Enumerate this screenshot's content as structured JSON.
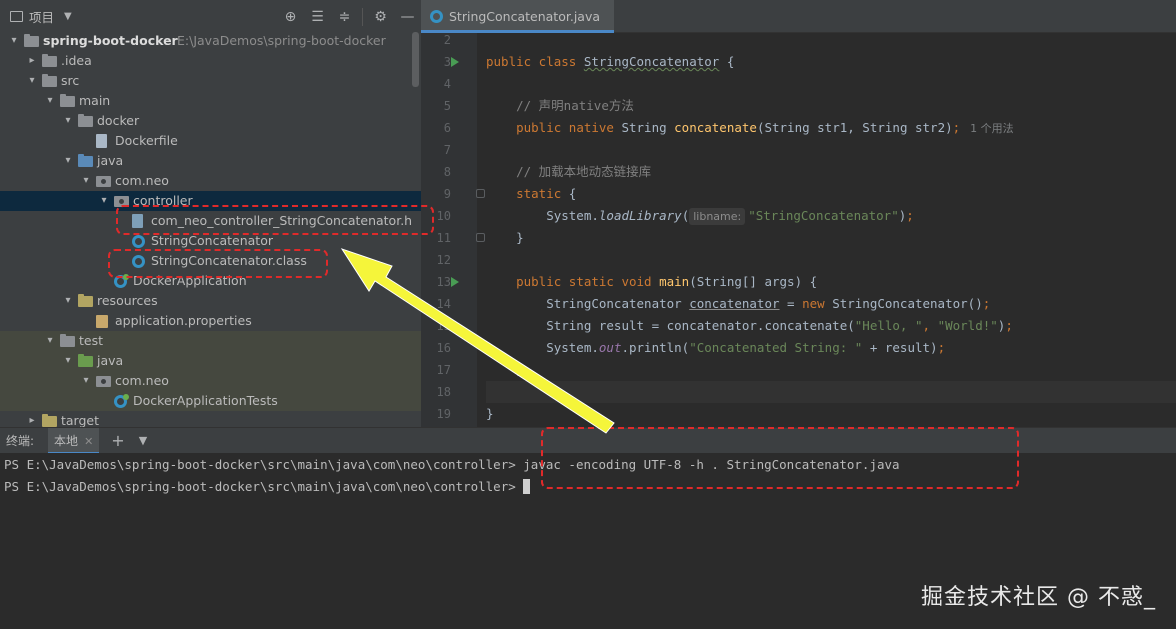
{
  "project_panel": {
    "title": "项目",
    "tree": [
      {
        "depth": 0,
        "arrow": "▾",
        "icon": "folder",
        "label": "spring-boot-docker",
        "hint": "E:\\JavaDemos\\spring-boot-docker",
        "bold": true
      },
      {
        "depth": 1,
        "arrow": "▸",
        "icon": "folder",
        "label": ".idea"
      },
      {
        "depth": 1,
        "arrow": "▾",
        "icon": "folder",
        "label": "src"
      },
      {
        "depth": 2,
        "arrow": "▾",
        "icon": "folder",
        "label": "main"
      },
      {
        "depth": 3,
        "arrow": "▾",
        "icon": "folder",
        "label": "docker"
      },
      {
        "depth": 4,
        "arrow": "",
        "icon": "file",
        "label": "Dockerfile"
      },
      {
        "depth": 3,
        "arrow": "▾",
        "icon": "folder-blue",
        "label": "java"
      },
      {
        "depth": 4,
        "arrow": "▾",
        "icon": "package",
        "label": "com.neo"
      },
      {
        "depth": 5,
        "arrow": "▾",
        "icon": "package",
        "label": "controller",
        "selected": true
      },
      {
        "depth": 6,
        "arrow": "",
        "icon": "file-h",
        "label": "com_neo_controller_StringConcatenator.h"
      },
      {
        "depth": 6,
        "arrow": "",
        "icon": "class",
        "label": "StringConcatenator"
      },
      {
        "depth": 6,
        "arrow": "",
        "icon": "class-file",
        "label": "StringConcatenator.class"
      },
      {
        "depth": 5,
        "arrow": "",
        "icon": "class-spring",
        "label": "DockerApplication"
      },
      {
        "depth": 3,
        "arrow": "▾",
        "icon": "folder-res",
        "label": "resources"
      },
      {
        "depth": 4,
        "arrow": "",
        "icon": "props",
        "label": "application.properties"
      },
      {
        "depth": 2,
        "arrow": "▾",
        "icon": "folder",
        "label": "test",
        "band": true
      },
      {
        "depth": 3,
        "arrow": "▾",
        "icon": "folder-green",
        "label": "java",
        "band": true
      },
      {
        "depth": 4,
        "arrow": "▾",
        "icon": "package",
        "label": "com.neo",
        "band": true
      },
      {
        "depth": 5,
        "arrow": "",
        "icon": "class-spring",
        "label": "DockerApplicationTests",
        "band": true
      },
      {
        "depth": 1,
        "arrow": "▸",
        "icon": "folder-res",
        "label": "target"
      }
    ]
  },
  "editor": {
    "tab_label": "StringConcatenator.java",
    "line_numbers": [
      "2",
      "3",
      "4",
      "5",
      "6",
      "7",
      "8",
      "9",
      "10",
      "11",
      "12",
      "13",
      "14",
      "15",
      "16",
      "17",
      "18",
      "19"
    ],
    "param_hint": "libname:",
    "usage_hint": "1 个用法",
    "comment_native": "// 声明native方法",
    "comment_load": "// 加载本地动态链接库",
    "string_lib": "\"StringConcatenator\"",
    "string_hello": "\"Hello, \"",
    "string_world": "\"World!\"",
    "string_concat": "\"Concatenated String: \""
  },
  "terminal": {
    "title": "终端:",
    "tab_label": "本地",
    "prompt": "PS E:\\JavaDemos\\spring-boot-docker\\src\\main\\java\\com\\neo\\controller>",
    "command": " javac -encoding UTF-8 -h . StringConcatenator.java"
  },
  "watermark": "掘金技术社区 @ 不惑_",
  "colors": {
    "annotation": "#e02a2a",
    "arrow": "#f5f53a",
    "keyword": "#cc7832",
    "function": "#ffc66d",
    "string": "#6a8759"
  }
}
